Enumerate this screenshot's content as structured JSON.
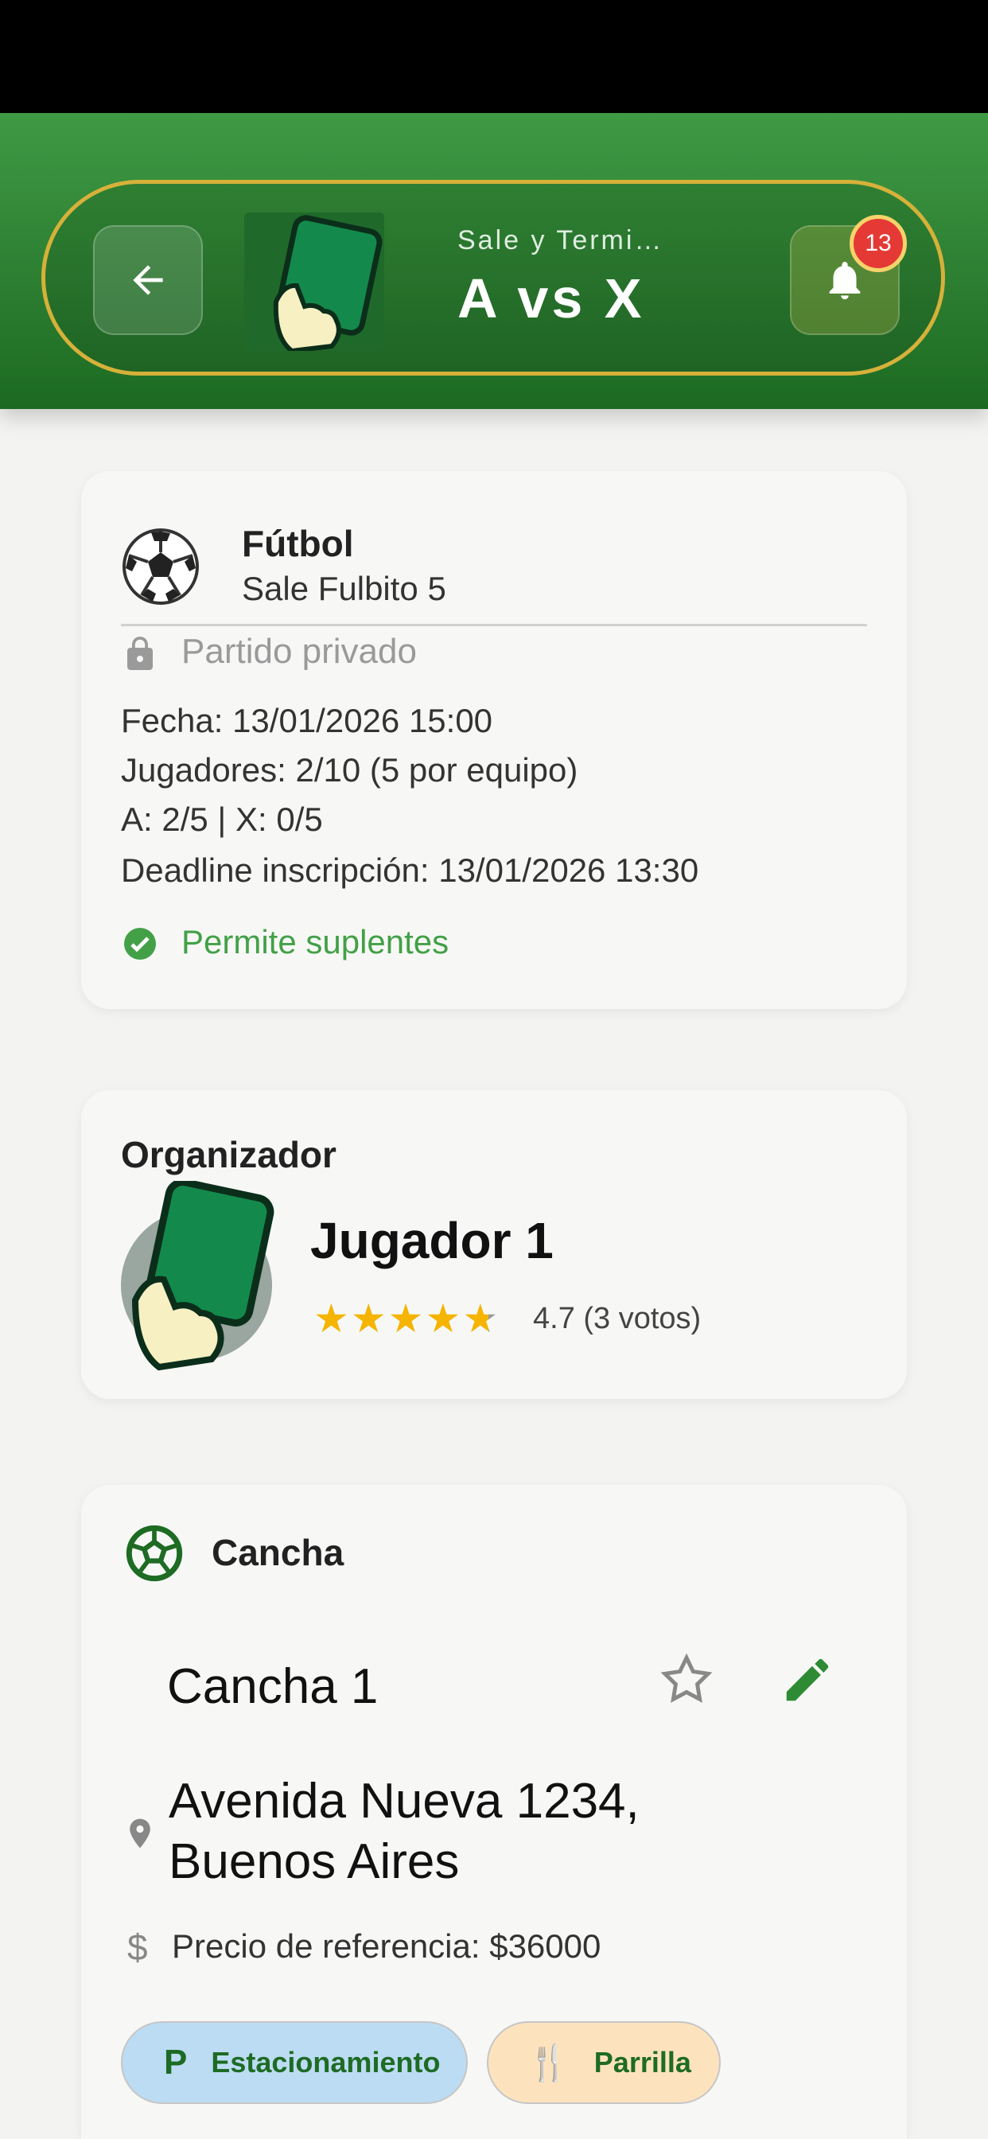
{
  "header": {
    "subtitle": "Sale y Termi…",
    "title": "A vs X",
    "notification_count": "13"
  },
  "match": {
    "sport": "Fútbol",
    "name": "Sale Fulbito 5",
    "privacy": "Partido privado",
    "info": [
      "Fecha: 13/01/2026 15:00",
      "Jugadores: 2/10 (5 por equipo)",
      "A: 2/5 | X: 0/5",
      "Deadline inscripción: 13/01/2026 13:30"
    ],
    "substitutes": "Permite suplentes"
  },
  "organizer": {
    "heading": "Organizador",
    "name": "Jugador 1",
    "rating_text": "4.7 (3 votos)",
    "rating_value": 4.7
  },
  "field": {
    "heading": "Cancha",
    "name": "Cancha 1",
    "address": "Avenida Nueva 1234, Buenos Aires",
    "price": "Precio de referencia: $36000",
    "amenities": [
      {
        "icon": "P",
        "label": "Estacionamiento"
      },
      {
        "icon": "🍴",
        "label": "Parrilla"
      }
    ]
  },
  "colors": {
    "primary": "#2d7f32",
    "accent": "#d6b13a",
    "success": "#43a047",
    "badge": "#e53935",
    "star": "#f5b400"
  }
}
